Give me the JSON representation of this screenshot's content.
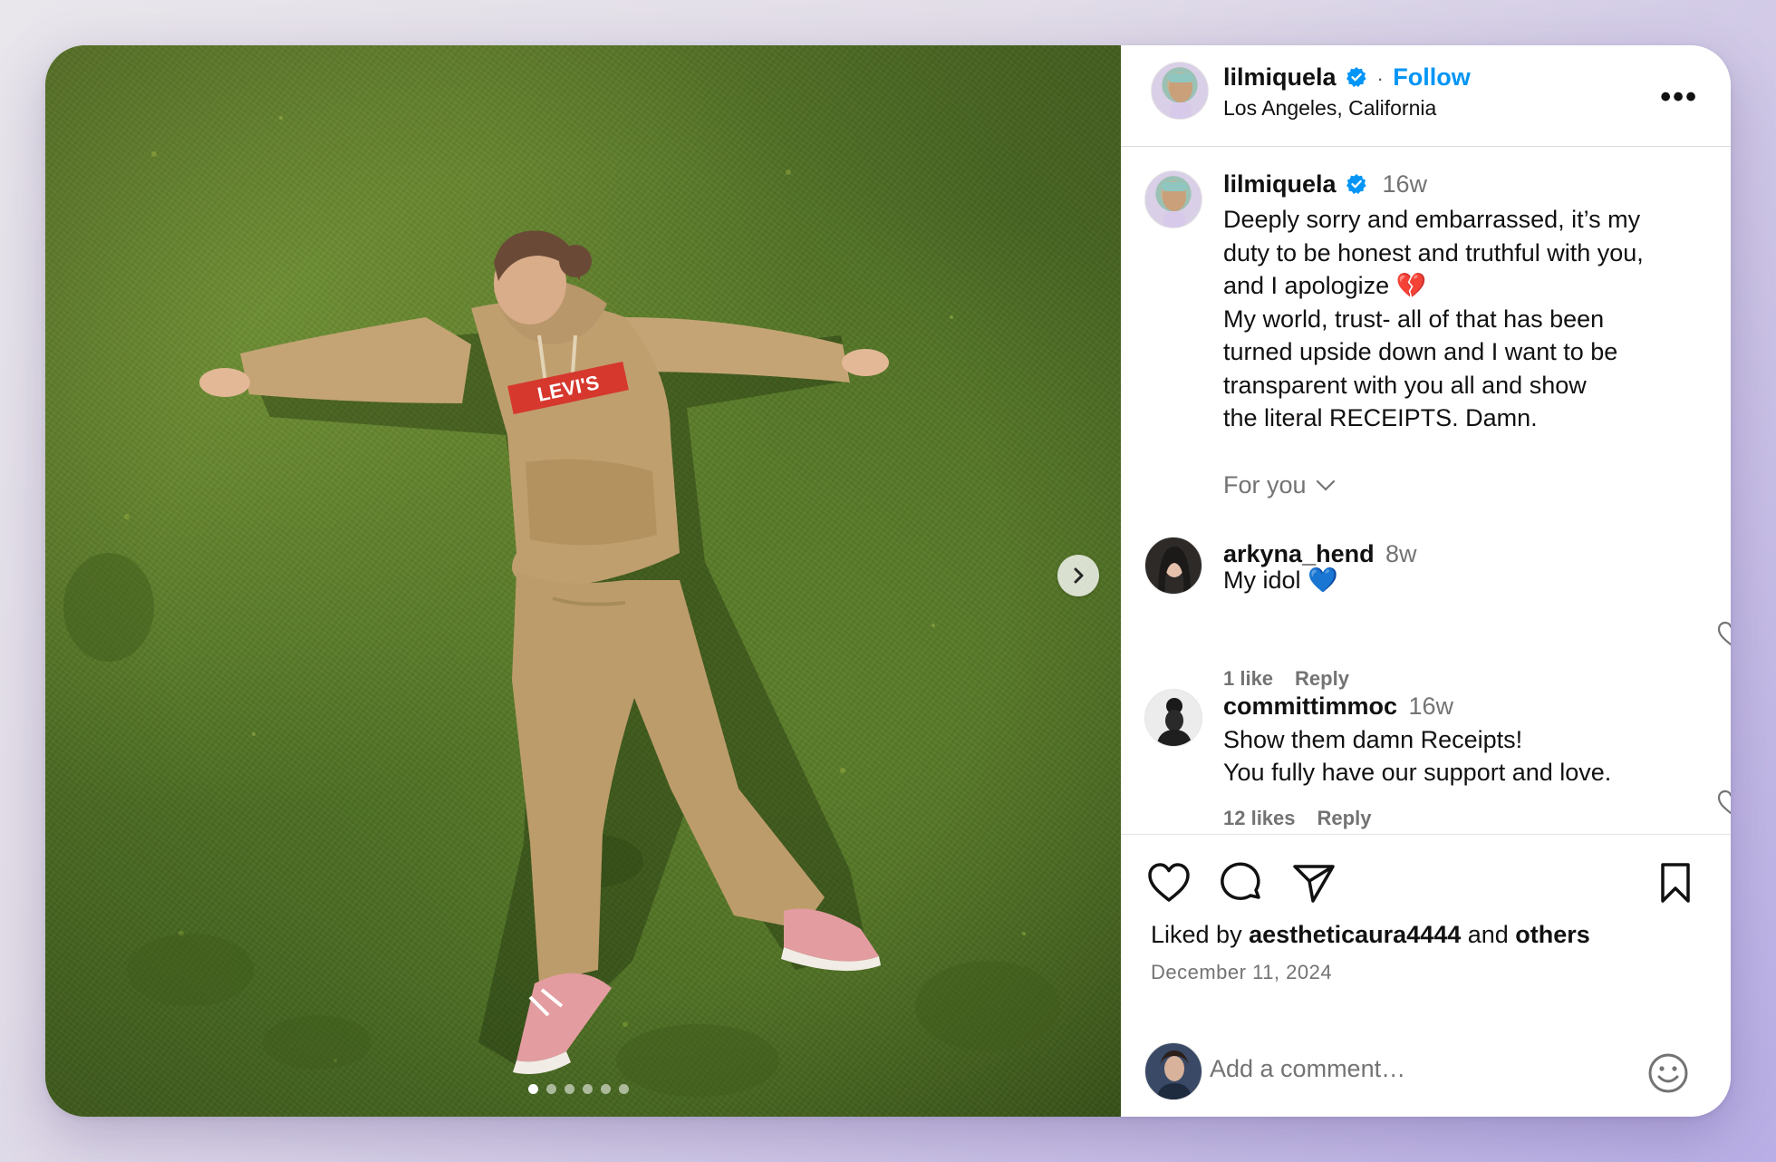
{
  "post": {
    "author": "lilmiquela",
    "follow_label": "Follow",
    "location": "Los Angeles, California",
    "more_label": "•••",
    "photo_alt": "",
    "carousel_total": 6,
    "carousel_index": 1
  },
  "caption": {
    "author": "lilmiquela",
    "time": "16w",
    "lines": [
      "Deeply sorry and embarrassed, it’s my",
      "duty to be honest and truthful with you,",
      "and I apologize 💔",
      "My world, trust- all of that has been",
      "turned upside down and I want to be",
      "transparent with you all and show",
      "the literal RECEIPTS. Damn."
    ]
  },
  "for_you_label": "For you",
  "comments": [
    {
      "author": "arkyna_hend",
      "time": "8w",
      "text": [
        "My idol 💙"
      ],
      "likes": "1 like",
      "reply": "Reply"
    },
    {
      "author": "committimmoc",
      "time": "16w",
      "text": [
        "Show them damn Receipts!",
        "You fully have our support and love."
      ],
      "likes": "12 likes",
      "reply": "Reply"
    }
  ],
  "likes": {
    "prefix": "Liked by ",
    "user": "aestheticaura4444",
    "middle": " and ",
    "others": "others"
  },
  "date": "December 11, 2024",
  "add_comment": {
    "placeholder": "Add a comment…"
  },
  "colors": {
    "accent": "#0095f6",
    "verified": "#0095f6",
    "muted": "#737373",
    "grass": "#587a27"
  },
  "icons": {
    "like": "heart-icon",
    "comment": "comment-bubble-icon",
    "share": "paper-plane-icon",
    "save": "bookmark-icon",
    "emoji": "smiley-icon",
    "next": "chevron-right-icon",
    "more": "more-horizontal-icon"
  }
}
